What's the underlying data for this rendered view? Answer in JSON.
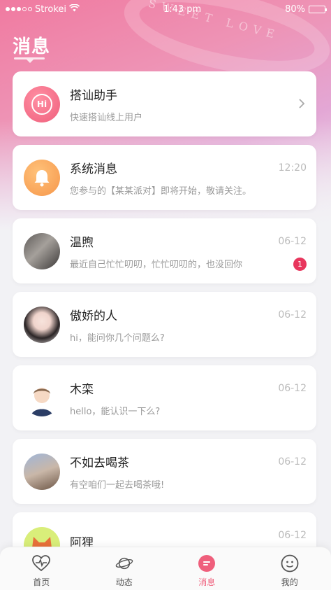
{
  "status_bar": {
    "carrier": "Strokei",
    "time": "1:43 pm",
    "battery": "80%",
    "battery_level": 0.8
  },
  "decoration": {
    "ribbon_text": "SWEET LOVE"
  },
  "header": {
    "title": "消息"
  },
  "assistant": {
    "name": "搭讪助手",
    "subtitle": "快速搭讪线上用户",
    "avatar_text": "Hi"
  },
  "conversations": [
    {
      "name": "系统消息",
      "preview": "您参与的【某某派对】即将开始，敬请关注。",
      "time": "12:20",
      "badge": ""
    },
    {
      "name": "温煦",
      "preview": "最近自己忙忙叨叨，忙忙叨叨的，也没回你",
      "time": "06-12",
      "badge": "1"
    },
    {
      "name": "傲娇的人",
      "preview": "hi，能问你几个问题么?",
      "time": "06-12",
      "badge": ""
    },
    {
      "name": "木栾",
      "preview": "hello，能认识一下么?",
      "time": "06-12",
      "badge": ""
    },
    {
      "name": "不如去喝茶",
      "preview": "有空咱们一起去喝茶哦!",
      "time": "06-12",
      "badge": ""
    },
    {
      "name": "阿狸",
      "preview": "",
      "time": "06-12",
      "badge": ""
    }
  ],
  "tabbar": {
    "items": [
      {
        "label": "首页",
        "icon": "heartbeat-icon",
        "active": false
      },
      {
        "label": "动态",
        "icon": "planet-icon",
        "active": false
      },
      {
        "label": "消息",
        "icon": "message-icon",
        "active": true
      },
      {
        "label": "我的",
        "icon": "smiley-icon",
        "active": false
      }
    ]
  },
  "colors": {
    "accent": "#ef5f7c",
    "badge": "#e8365d",
    "bell": "#f6964a"
  }
}
